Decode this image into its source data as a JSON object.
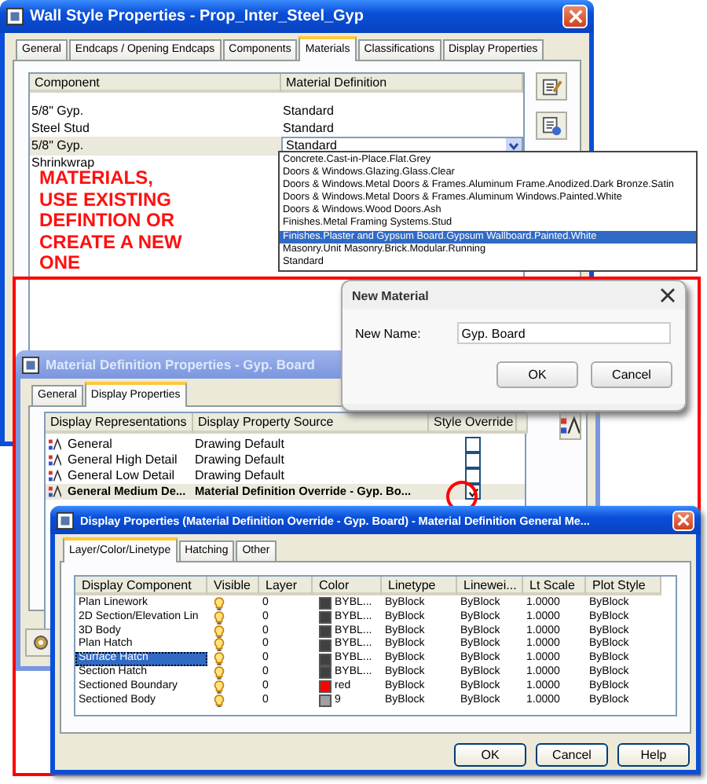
{
  "wall_style_window": {
    "title": "Wall Style Properties - Prop_Inter_Steel_Gyp",
    "tabs": [
      {
        "label": "General",
        "selected": false
      },
      {
        "label": "Endcaps / Opening Endcaps",
        "selected": false
      },
      {
        "label": "Components",
        "selected": false
      },
      {
        "label": "Materials",
        "selected": true
      },
      {
        "label": "Classifications",
        "selected": false
      },
      {
        "label": "Display Properties",
        "selected": false
      }
    ],
    "columns": [
      "Component",
      "Material Definition"
    ],
    "rows": [
      {
        "component": "5/8\" Gyp.",
        "material": "Standard",
        "selected": false
      },
      {
        "component": "Steel Stud",
        "material": "Standard",
        "selected": false
      },
      {
        "component": "5/8\" Gyp.",
        "material": "Standard",
        "selected": true
      },
      {
        "component": "Shrinkwrap",
        "selected": false
      }
    ],
    "dropdown_options": [
      {
        "label": "Concrete.Cast-in-Place.Flat.Grey",
        "selected": false
      },
      {
        "label": "Doors & Windows.Glazing.Glass.Clear",
        "selected": false
      },
      {
        "label": "Doors & Windows.Metal Doors & Frames.Aluminum Frame.Anodized.Dark Bronze.Satin",
        "selected": false
      },
      {
        "label": "Doors & Windows.Metal Doors & Frames.Aluminum Windows.Painted.White",
        "selected": false
      },
      {
        "label": "Doors & Windows.Wood Doors.Ash",
        "selected": false
      },
      {
        "label": "Finishes.Metal Framing Systems.Stud",
        "selected": false
      },
      {
        "label": "Finishes.Plaster and Gypsum Board.Gypsum Wallboard.Painted.White",
        "selected": true
      },
      {
        "label": "Masonry.Unit Masonry.Brick.Modular.Running",
        "selected": false
      },
      {
        "label": "Standard",
        "selected": false
      }
    ]
  },
  "annotation": "MATERIALS, USE EXISTING DEFINTION OR CREATE A NEW ONE",
  "material_definition_window": {
    "title": "Material Definition Properties - Gyp. Board",
    "tabs": [
      {
        "label": "General",
        "selected": false
      },
      {
        "label": "Display Properties",
        "selected": true
      }
    ],
    "columns": [
      "Display Representations",
      "Display Property Source",
      "Style Override"
    ],
    "rows": [
      {
        "name": "General",
        "source": "Drawing Default",
        "override": false,
        "selected": false
      },
      {
        "name": "General High Detail",
        "source": "Drawing Default",
        "override": false,
        "selected": false
      },
      {
        "name": "General Low Detail",
        "source": "Drawing Default",
        "override": false,
        "selected": false
      },
      {
        "name": "General Medium De...",
        "source": "Material Definition Override - Gyp. Bo...",
        "override": true,
        "selected": true
      }
    ]
  },
  "new_material_dialog": {
    "title": "New Material",
    "label": "New Name:",
    "value": "Gyp. Board",
    "buttons": [
      "OK",
      "Cancel"
    ]
  },
  "display_properties_window": {
    "title": "Display Properties (Material Definition Override - Gyp. Board) - Material Definition General Me...",
    "tabs": [
      {
        "label": "Layer/Color/Linetype",
        "selected": true
      },
      {
        "label": "Hatching",
        "selected": false
      },
      {
        "label": "Other",
        "selected": false
      }
    ],
    "columns": [
      "Display Component",
      "Visible",
      "Layer",
      "Color",
      "Linetype",
      "Linewei...",
      "Lt Scale",
      "Plot Style"
    ],
    "rows": [
      {
        "component": "Plan Linework",
        "visible": true,
        "layer": "0",
        "color": "#404040",
        "color_label": "BYBL...",
        "linetype": "ByBlock",
        "lineweight": "ByBlock",
        "lt_scale": "1.0000",
        "plot_style": "ByBlock",
        "selected": false
      },
      {
        "component": "2D Section/Elevation Lin",
        "visible": true,
        "layer": "0",
        "color": "#404040",
        "color_label": "BYBL...",
        "linetype": "ByBlock",
        "lineweight": "ByBlock",
        "lt_scale": "1.0000",
        "plot_style": "ByBlock",
        "selected": false
      },
      {
        "component": "3D Body",
        "visible": true,
        "layer": "0",
        "color": "#404040",
        "color_label": "BYBL...",
        "linetype": "ByBlock",
        "lineweight": "ByBlock",
        "lt_scale": "1.0000",
        "plot_style": "ByBlock",
        "selected": false
      },
      {
        "component": "Plan Hatch",
        "visible": true,
        "layer": "0",
        "color": "#404040",
        "color_label": "BYBL...",
        "linetype": "ByBlock",
        "lineweight": "ByBlock",
        "lt_scale": "1.0000",
        "plot_style": "ByBlock",
        "selected": false
      },
      {
        "component": "Surface Hatch",
        "visible": true,
        "layer": "0",
        "color": "#404040",
        "color_label": "BYBL...",
        "linetype": "ByBlock",
        "lineweight": "ByBlock",
        "lt_scale": "1.0000",
        "plot_style": "ByBlock",
        "selected": true
      },
      {
        "component": "Section Hatch",
        "visible": true,
        "layer": "0",
        "color": "#404040",
        "color_label": "BYBL...",
        "linetype": "ByBlock",
        "lineweight": "ByBlock",
        "lt_scale": "1.0000",
        "plot_style": "ByBlock",
        "selected": false
      },
      {
        "component": "Sectioned Boundary",
        "visible": true,
        "layer": "0",
        "color": "#ff0000",
        "color_label": "red",
        "linetype": "ByBlock",
        "lineweight": "ByBlock",
        "lt_scale": "1.0000",
        "plot_style": "ByBlock",
        "selected": false
      },
      {
        "component": "Sectioned Body",
        "visible": true,
        "layer": "0",
        "color": "#a0a0a0",
        "color_label": "9",
        "linetype": "ByBlock",
        "lineweight": "ByBlock",
        "lt_scale": "1.0000",
        "plot_style": "ByBlock",
        "selected": false
      }
    ],
    "buttons": [
      "OK",
      "Cancel",
      "Help"
    ]
  }
}
